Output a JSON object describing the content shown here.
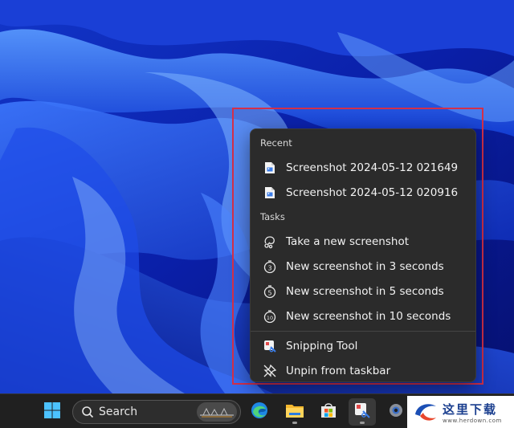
{
  "menu": {
    "recent_header": "Recent",
    "recent": [
      {
        "label": "Screenshot 2024-05-12 021649",
        "icon": "image-file-icon"
      },
      {
        "label": "Screenshot 2024-05-12 020916",
        "icon": "image-file-icon"
      }
    ],
    "tasks_header": "Tasks",
    "tasks": [
      {
        "label": "Take a new screenshot",
        "icon": "snip-icon"
      },
      {
        "label": "New screenshot in 3 seconds",
        "icon": "timer-3-icon"
      },
      {
        "label": "New screenshot in 5 seconds",
        "icon": "timer-5-icon"
      },
      {
        "label": "New screenshot in 10 seconds",
        "icon": "timer-10-icon"
      }
    ],
    "app_items": [
      {
        "label": "Snipping Tool",
        "icon": "snipping-tool-icon"
      },
      {
        "label": "Unpin from taskbar",
        "icon": "unpin-icon"
      }
    ]
  },
  "taskbar": {
    "search_label": "Search",
    "apps": [
      "start-icon",
      "edge-icon",
      "file-explorer-icon",
      "microsoft-store-icon",
      "snipping-tool-icon",
      "settings-icon"
    ]
  },
  "watermark": {
    "title": "这里下载",
    "url": "www.herdown.com"
  },
  "colors": {
    "menu_bg": "#2b2b2b",
    "highlight": "#d3304a",
    "taskbar_bg": "#202020"
  }
}
